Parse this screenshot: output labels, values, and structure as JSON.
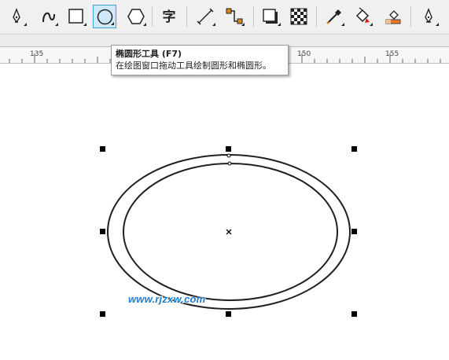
{
  "toolbar": {
    "tools": [
      {
        "icon": "pen-nib-icon",
        "has_flyout": true
      },
      {
        "icon": "curve-hook-icon",
        "has_flyout": true
      },
      {
        "icon": "rectangle-icon",
        "has_flyout": true
      },
      {
        "icon": "ellipse-icon",
        "has_flyout": true,
        "active": true
      },
      {
        "icon": "hexagon-icon",
        "has_flyout": true
      },
      {
        "icon": "text-tool-icon",
        "has_flyout": false
      },
      {
        "icon": "dimension-line-icon",
        "has_flyout": true
      },
      {
        "icon": "connector-icon",
        "has_flyout": true
      },
      {
        "icon": "drop-shadow-icon",
        "has_flyout": true
      },
      {
        "icon": "transparency-checker-icon",
        "has_flyout": false
      },
      {
        "icon": "eyedropper-icon",
        "has_flyout": true
      },
      {
        "icon": "paint-bucket-icon",
        "has_flyout": true
      },
      {
        "icon": "smart-fill-icon",
        "has_flyout": false
      },
      {
        "icon": "outline-pen-icon",
        "has_flyout": true
      }
    ],
    "text_tool_glyph": "字"
  },
  "ruler": {
    "labels": [
      "135",
      "150",
      "155"
    ]
  },
  "tooltip": {
    "title": "椭圆形工具 (F7)",
    "description": "在绘图窗口拖动工具绘制圆形和椭圆形。"
  },
  "watermark": {
    "text": "www.rjzxw.com"
  },
  "colors": {
    "accent": "#3f9fd8",
    "watermark": "#1d7fd0",
    "shape_outline": "#231f20",
    "handle": "#000000"
  }
}
